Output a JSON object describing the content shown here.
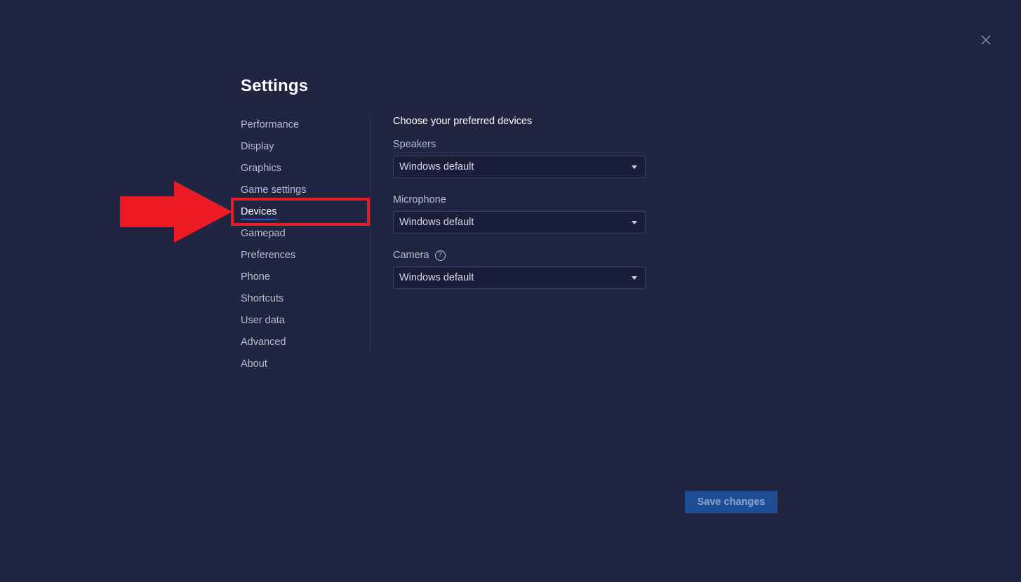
{
  "window": {
    "close_icon": "close-icon"
  },
  "title": "Settings",
  "sidebar": {
    "items": [
      {
        "label": "Performance",
        "active": false
      },
      {
        "label": "Display",
        "active": false
      },
      {
        "label": "Graphics",
        "active": false
      },
      {
        "label": "Game settings",
        "active": false
      },
      {
        "label": "Devices",
        "active": true
      },
      {
        "label": "Gamepad",
        "active": false
      },
      {
        "label": "Preferences",
        "active": false
      },
      {
        "label": "Phone",
        "active": false
      },
      {
        "label": "Shortcuts",
        "active": false
      },
      {
        "label": "User data",
        "active": false
      },
      {
        "label": "Advanced",
        "active": false
      },
      {
        "label": "About",
        "active": false
      }
    ]
  },
  "devices": {
    "heading": "Choose your preferred devices",
    "speakers": {
      "label": "Speakers",
      "value": "Windows default"
    },
    "microphone": {
      "label": "Microphone",
      "value": "Windows default"
    },
    "camera": {
      "label": "Camera",
      "help_icon": "help-circle-icon",
      "help_glyph": "?",
      "value": "Windows default"
    }
  },
  "footer": {
    "save_label": "Save changes"
  },
  "annotation": {
    "color": "#e51e25",
    "target": "Devices"
  },
  "colors": {
    "background": "#222541",
    "select_bg": "#1b1e3a",
    "accent_underline": "#4d8cff",
    "save_button_bg": "#1f4e96"
  }
}
